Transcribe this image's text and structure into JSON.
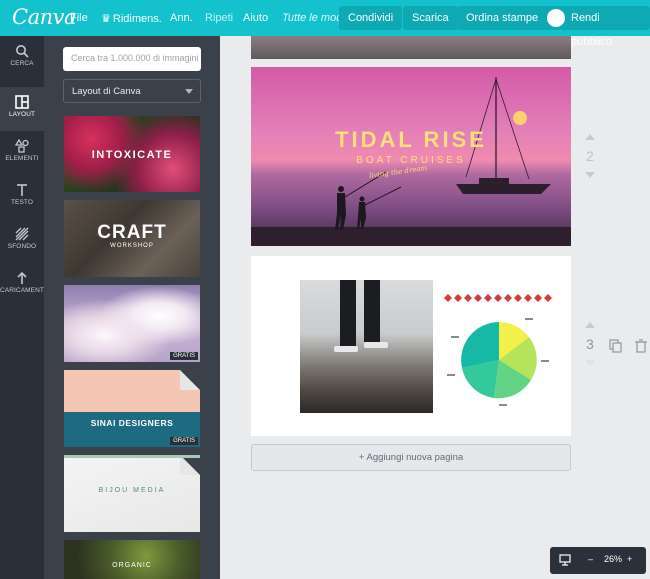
{
  "app": {
    "logo": "Canva"
  },
  "menu": {
    "file": "File",
    "resize": "Ridimens.",
    "undo": "Ann.",
    "redo": "Ripeti",
    "help": "Aiuto",
    "saved_status": "Tutte le modifiche",
    "share": "Condividi",
    "download": "Scarica",
    "order_prints": "Ordina stampe",
    "publish": "Rendi pubblico"
  },
  "nav": {
    "search": "CERCA",
    "layout": "LAYOUT",
    "elements": "ELEMENTI",
    "text": "TESTO",
    "background": "SFONDO",
    "uploads": "CARICAMENTI"
  },
  "panel": {
    "search_placeholder": "Cerca tra 1.000.000 di immagini",
    "layout_select": "Layout di Canva",
    "thumbs": {
      "t1": "INTOXICATE",
      "t2": "CRAFT",
      "t2_sub": "WORKSHOP",
      "t4": "SINAI DESIGNERS",
      "t5": "BIJOU MEDIA",
      "t6": "ORGANIC"
    },
    "badge": "GRATIS"
  },
  "canvas": {
    "page2_num": "2",
    "page3_num": "3",
    "poster_title": "TIDAL RISE",
    "poster_subtitle": "BOAT CRUISES",
    "poster_script": "living the dream",
    "add_page": "+ Aggiungi nuova pagina"
  },
  "zoom": {
    "minus": "–",
    "value": "26%",
    "plus": "+"
  },
  "colors": {
    "brand": "#13c2cd",
    "nav_bg": "#293039",
    "panel_bg": "#3a414a"
  }
}
